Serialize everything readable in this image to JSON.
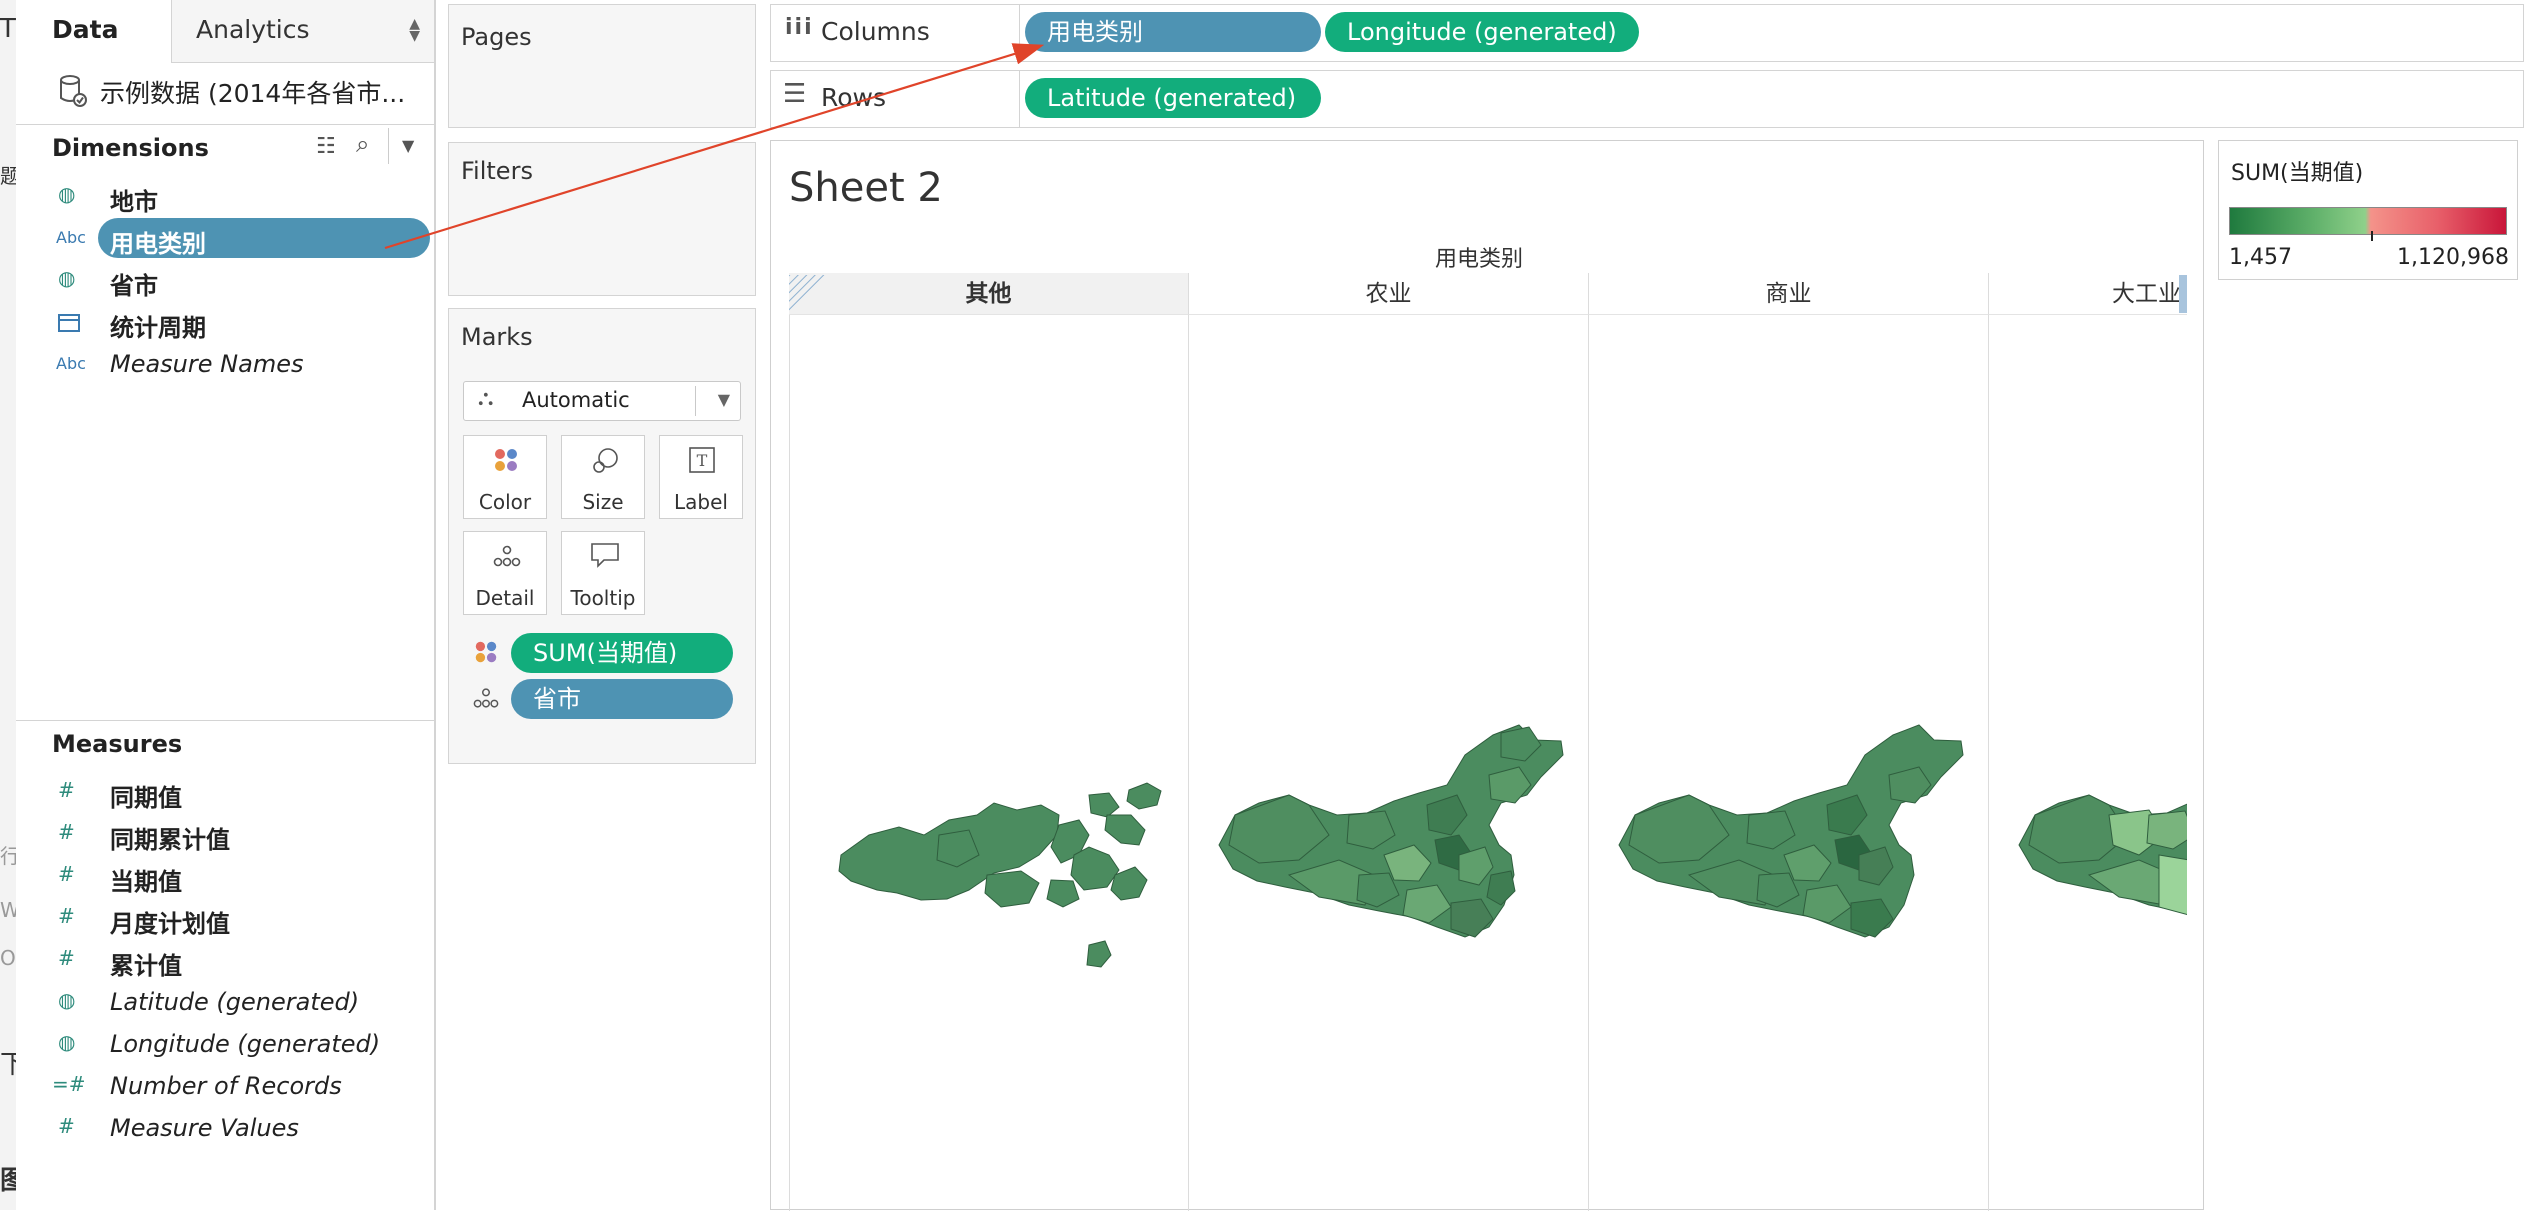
{
  "edge_glyphs": [
    "T",
    "题",
    "行",
    "W",
    "O",
    "下",
    "图"
  ],
  "data_pane": {
    "tabs": {
      "data": "Data",
      "analytics": "Analytics"
    },
    "datasource": "示例数据 (2014年各省市...",
    "dimensions_title": "Dimensions",
    "dimensions": [
      {
        "label": "地市",
        "icon": "globe-icon",
        "type": "geo"
      },
      {
        "label": "用电类别",
        "icon": "abc-icon",
        "type": "abc",
        "selected": true
      },
      {
        "label": "省市",
        "icon": "globe-icon",
        "type": "geo"
      },
      {
        "label": "统计周期",
        "icon": "calendar-icon",
        "type": "date"
      },
      {
        "label": "Measure Names",
        "icon": "abc-icon",
        "type": "abc",
        "italic": true
      }
    ],
    "measures_title": "Measures",
    "measures": [
      {
        "label": "同期值",
        "icon": "hash-icon"
      },
      {
        "label": "同期累计值",
        "icon": "hash-icon"
      },
      {
        "label": "当期值",
        "icon": "hash-icon"
      },
      {
        "label": "月度计划值",
        "icon": "hash-icon"
      },
      {
        "label": "累计值",
        "icon": "hash-icon"
      },
      {
        "label": "Latitude (generated)",
        "icon": "globe-icon",
        "italic": true
      },
      {
        "label": "Longitude (generated)",
        "icon": "globe-icon",
        "italic": true
      },
      {
        "label": "Number of Records",
        "icon": "hash-icon",
        "italic": true
      },
      {
        "label": "Measure Values",
        "icon": "hash-icon",
        "italic": true
      }
    ]
  },
  "cards": {
    "pages": "Pages",
    "filters": "Filters",
    "marks": "Marks",
    "mark_type": "Automatic",
    "mark_buttons": [
      "Color",
      "Size",
      "Label",
      "Detail",
      "Tooltip"
    ],
    "mark_pills": [
      {
        "label": "SUM(当期值)",
        "kind": "color"
      },
      {
        "label": "省市",
        "kind": "detail"
      }
    ]
  },
  "shelves": {
    "columns_label": "Columns",
    "columns": [
      "用电类别",
      "Longitude (generated)"
    ],
    "rows_label": "Rows",
    "rows": [
      "Latitude (generated)"
    ]
  },
  "sheet": {
    "title": "Sheet 2",
    "header_group": "用电类别",
    "columns": [
      "其他",
      "农业",
      "商业",
      "大工业"
    ]
  },
  "legend": {
    "title": "SUM(当期值)",
    "min": "1,457",
    "max": "1,120,968",
    "colors": {
      "low": "#1f7a3e",
      "mid_low": "#8fd08a",
      "mid_high": "#f4938a",
      "high": "#c9163a"
    }
  },
  "colors": {
    "pill_blue": "#4e93b3",
    "pill_green": "#12ad7c",
    "map_fill": "#4b8c5f",
    "annotation": "#e0442a"
  }
}
